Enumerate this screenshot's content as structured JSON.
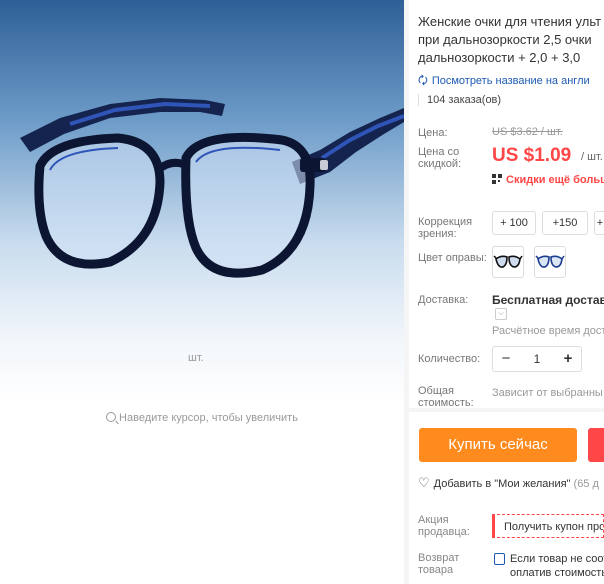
{
  "product": {
    "title_line1": "Женские очки для чтения ульт",
    "title_line2": "при дальнозоркости 2,5 очки",
    "title_line3": "дальнозоркости + 2,0 + 3,0",
    "translate_link": "Посмотреть название на англи",
    "orders": "104 заказа(ов)",
    "image_hint": "Наведите курсор, чтобы увеличить"
  },
  "price": {
    "label": "Цена:",
    "old": "US $3.62 / шт.",
    "discount_label_1": "Цена со",
    "discount_label_2": "скидкой:",
    "new": "US $1.09",
    "unit": "/ шт.",
    "more_discounts": "Скидки ещё больш"
  },
  "options": {
    "correction_label_1": "Коррекция",
    "correction_label_2": "зрения:",
    "correction_values": [
      "+ 100",
      "+150",
      "+"
    ],
    "frame_color_label": "Цвет оправы:"
  },
  "shipping": {
    "label": "Доставка:",
    "title": "Бесплатная доставка",
    "time": "Расчётное время дост"
  },
  "quantity": {
    "label": "Количество:",
    "value": "1",
    "minus": "−",
    "plus": "+",
    "unit": "шт."
  },
  "total": {
    "label_1": "Общая",
    "label_2": "стоимость:",
    "note": "Зависит от выбранны"
  },
  "actions": {
    "buy_now": "Купить сейчас",
    "wishlist": "Добавить в \"Мои желания\"",
    "wishlist_count": "(65 д"
  },
  "promo": {
    "seller_label_1": "Акция",
    "seller_label_2": "продавца:",
    "coupon": "Получить купон про",
    "return_label_1": "Возврат",
    "return_label_2": "товара",
    "return_line1": "Если товар не соот",
    "return_line2": "оплатив стоимость"
  },
  "icons": {
    "search": "magnifier-icon",
    "translate": "translate-icon",
    "qr": "qr-code-icon",
    "heart": "heart-icon",
    "return": "return-icon"
  },
  "colors": {
    "price_red": "#ff4747",
    "buy_orange": "#ff8a1d",
    "link_blue": "#1d5bb3",
    "frame_blue": "#1b3d8f"
  }
}
